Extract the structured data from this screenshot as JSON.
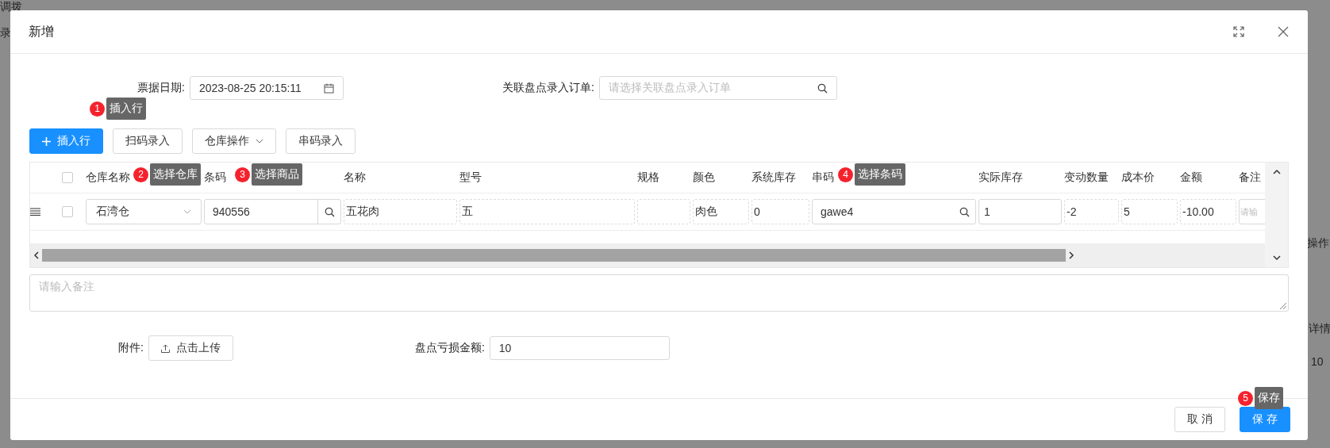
{
  "background": {
    "texts": [
      "调拨",
      "录",
      "操作",
      "详情",
      "10"
    ]
  },
  "dialog": {
    "title": "新增"
  },
  "form": {
    "date": {
      "label": "票据日期:",
      "value": "2023-08-25 20:15:11"
    },
    "order": {
      "label": "关联盘点录入订单:",
      "placeholder": "请选择关联盘点录入订单"
    }
  },
  "toolbar": [
    {
      "label": "插入行",
      "kind": "primary"
    },
    {
      "label": "扫码录入",
      "kind": "default"
    },
    {
      "label": "仓库操作",
      "kind": "dropdown"
    },
    {
      "label": "串码录入",
      "kind": "default"
    }
  ],
  "table": {
    "header_checked": false,
    "columns": [
      "仓库名称",
      "条码",
      "名称",
      "型号",
      "规格",
      "颜色",
      "系统库存",
      "串码",
      "实际库存",
      "变动数量",
      "成本价",
      "金额",
      "备注"
    ],
    "rows": [
      {
        "checked": false,
        "cells": [
          {
            "kind": "select",
            "value": "石湾仓"
          },
          {
            "kind": "search",
            "value": "940556",
            "button": true
          },
          {
            "kind": "text",
            "value": "五花肉"
          },
          {
            "kind": "text",
            "value": "五"
          },
          {
            "kind": "text"
          },
          {
            "kind": "text",
            "value": "肉色"
          },
          {
            "kind": "text",
            "value": "0"
          },
          {
            "kind": "search",
            "value": "gawe4",
            "button": false
          },
          {
            "kind": "input",
            "value": "1"
          },
          {
            "kind": "text",
            "value": "-2"
          },
          {
            "kind": "text",
            "value": "5"
          },
          {
            "kind": "text",
            "value": "-10.00"
          },
          {
            "kind": "input",
            "placeholder": "请输"
          }
        ]
      }
    ]
  },
  "remark": {
    "placeholder": "请输入备注"
  },
  "attachment": {
    "label": "附件:",
    "button": "点击上传"
  },
  "loss": {
    "label": "盘点亏损金额:",
    "value": "10"
  },
  "footer": [
    {
      "label": "取 消",
      "kind": "default"
    },
    {
      "label": "保 存",
      "kind": "primary"
    }
  ],
  "tips": [
    {
      "number": "1",
      "text": "插入行"
    },
    {
      "number": "2",
      "text": "选择仓库"
    },
    {
      "number": "3",
      "text": "选择商品"
    },
    {
      "number": "4",
      "text": "选择条码"
    },
    {
      "number": "5",
      "text": "保存"
    }
  ]
}
